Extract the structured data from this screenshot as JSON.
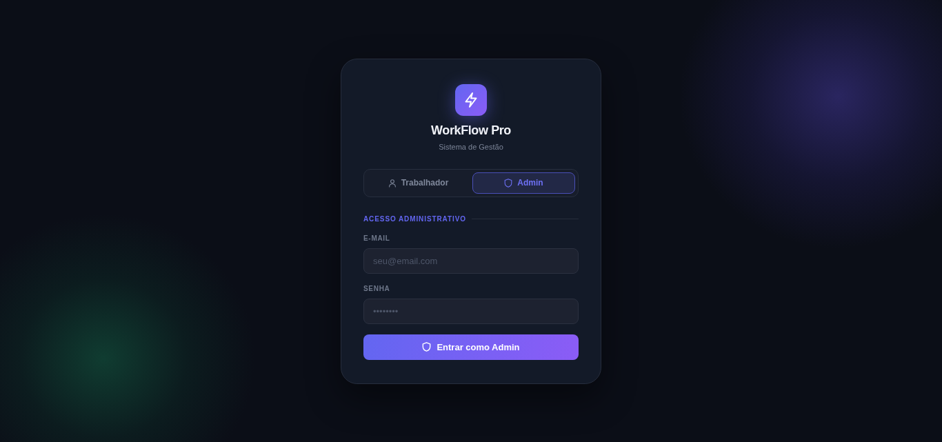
{
  "app": {
    "title": "WorkFlow Pro",
    "subtitle": "Sistema de Gestão"
  },
  "role_tabs": [
    {
      "label": "Trabalhador",
      "kind": "worker",
      "selected": false
    },
    {
      "label": "Admin",
      "kind": "admin",
      "selected": true
    }
  ],
  "form": {
    "heading": "ACESSO ADMINISTRATIVO",
    "fields": [
      {
        "label": "E-MAIL",
        "placeholder": "seu@email.com"
      },
      {
        "label": "SENHA",
        "placeholder": "••••••••"
      }
    ],
    "submit": {
      "label": "Entrar como Admin"
    }
  }
}
